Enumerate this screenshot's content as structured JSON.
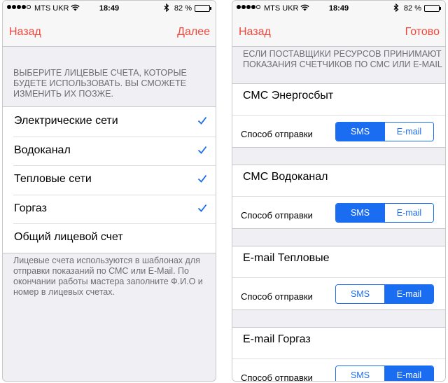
{
  "colors": {
    "accent_nav": "#f2483c",
    "segment_blue": "#1a6cf0",
    "group_bg": "#efeff4"
  },
  "statusbar": {
    "carrier": "MTS UKR",
    "time": "18:49",
    "battery": "82 %",
    "battery_level": 0.82
  },
  "left": {
    "nav": {
      "back": "Назад",
      "next": "Далее"
    },
    "header": "ВЫБЕРИТЕ ЛИЦЕВЫЕ СЧЕТА, КОТОРЫЕ БУДЕТЕ ИСПОЛЬЗОВАТЬ. ВЫ СМОЖЕТЕ ИЗМЕНИТЬ ИХ ПОЗЖЕ.",
    "accounts": [
      {
        "label": "Электрические сети",
        "checked": true
      },
      {
        "label": "Водоканал",
        "checked": true
      },
      {
        "label": "Тепловые сети",
        "checked": true
      },
      {
        "label": "Горгаз",
        "checked": true
      },
      {
        "label": "Общий лицевой счет",
        "checked": false
      }
    ],
    "footer": "Лицевые счета используются в шаблонах для отправки показаний по СМС или E-Mail. По окончании работы мастера заполните Ф.И.О и номер в лицевых счетах."
  },
  "right": {
    "nav": {
      "back": "Назад",
      "done": "Готово"
    },
    "header": "ЕСЛИ ПОСТАВЩИКИ РЕСУРСОВ ПРИНИМАЮТ ПОКАЗАНИЯ СЧЕТЧИКОВ ПО СМС ИЛИ E-MAIL",
    "send_label": "Способ отправки",
    "options": [
      "SMS",
      "E-mail"
    ],
    "providers": [
      {
        "title": "СМС Энергосбыт",
        "selected": "SMS"
      },
      {
        "title": "СМС Водоканал",
        "selected": "SMS"
      },
      {
        "title": "E-mail Тепловые",
        "selected": "E-mail"
      },
      {
        "title": "E-mail Горгаз",
        "selected": "E-mail"
      }
    ]
  }
}
